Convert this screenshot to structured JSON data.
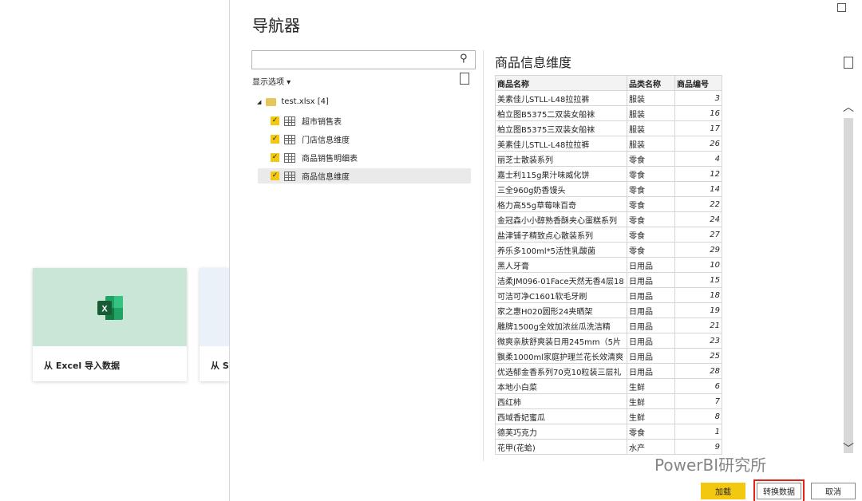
{
  "background": {
    "cards": [
      {
        "label": "从 Excel 导入数据"
      },
      {
        "label": "从 S"
      }
    ]
  },
  "dialog": {
    "title": "导航器",
    "display_options": "显示选项 ▾",
    "search": {
      "placeholder": "",
      "value": ""
    },
    "tree": {
      "root": "test.xlsx [4]",
      "items": [
        {
          "label": "超市销售表",
          "checked": true
        },
        {
          "label": "门店信息维度",
          "checked": true
        },
        {
          "label": "商品销售明细表",
          "checked": true
        },
        {
          "label": "商品信息维度",
          "checked": true,
          "selected": true
        }
      ]
    },
    "preview": {
      "title": "商品信息维度",
      "columns": [
        "商品名称",
        "品类名称",
        "商品编号"
      ],
      "rows": [
        [
          "美素佳儿STLL-L48拉拉裤",
          "服装",
          "3"
        ],
        [
          "柏立图B5375二双装女船袜",
          "服装",
          "16"
        ],
        [
          "柏立图B5375三双装女船袜",
          "服装",
          "17"
        ],
        [
          "美素佳儿STLL-L48拉拉裤",
          "服装",
          "26"
        ],
        [
          "丽芝士散装系列",
          "零食",
          "4"
        ],
        [
          "嘉士利115g果汁味威化饼",
          "零食",
          "12"
        ],
        [
          "三全960g奶香馒头",
          "零食",
          "14"
        ],
        [
          "格力高55g草莓味百奇",
          "零食",
          "22"
        ],
        [
          "金冠森小小醇熟香酥夹心蛋糕系列",
          "零食",
          "24"
        ],
        [
          "盐津铺子精致点心散装系列",
          "零食",
          "27"
        ],
        [
          "养乐多100ml*5活性乳酸菌",
          "零食",
          "29"
        ],
        [
          "黑人牙膏",
          "日用品",
          "10"
        ],
        [
          "洁柔JM096-01Face天然无香4层18",
          "日用品",
          "15"
        ],
        [
          "可洁可净C1601软毛牙刷",
          "日用品",
          "18"
        ],
        [
          "家之惠H020圆形24夹晒架",
          "日用品",
          "19"
        ],
        [
          "雕牌1500g全效加浓丝瓜洗洁精",
          "日用品",
          "21"
        ],
        [
          "微爽亲肤舒爽装日用245mm（5片",
          "日用品",
          "23"
        ],
        [
          "飘柔1000ml家庭护理兰花长效清爽",
          "日用品",
          "25"
        ],
        [
          "优选郁金香系列70克10粒装三层礼",
          "日用品",
          "28"
        ],
        [
          "本地小白菜",
          "生鲜",
          "6"
        ],
        [
          "西红柿",
          "生鲜",
          "7"
        ],
        [
          "西域香妃蜜瓜",
          "生鲜",
          "8"
        ],
        [
          "德芙巧克力",
          "零食",
          "1"
        ],
        [
          "花甲(花蛤)",
          "水产",
          "9"
        ]
      ]
    },
    "buttons": {
      "load": "加载",
      "transform": "转换数据",
      "cancel": "取消"
    },
    "watermark": "PowerBI研究所"
  },
  "colors": {
    "accent": "#f2c811",
    "highlight": "#e32119",
    "excel_card": "#c9e6d6"
  }
}
